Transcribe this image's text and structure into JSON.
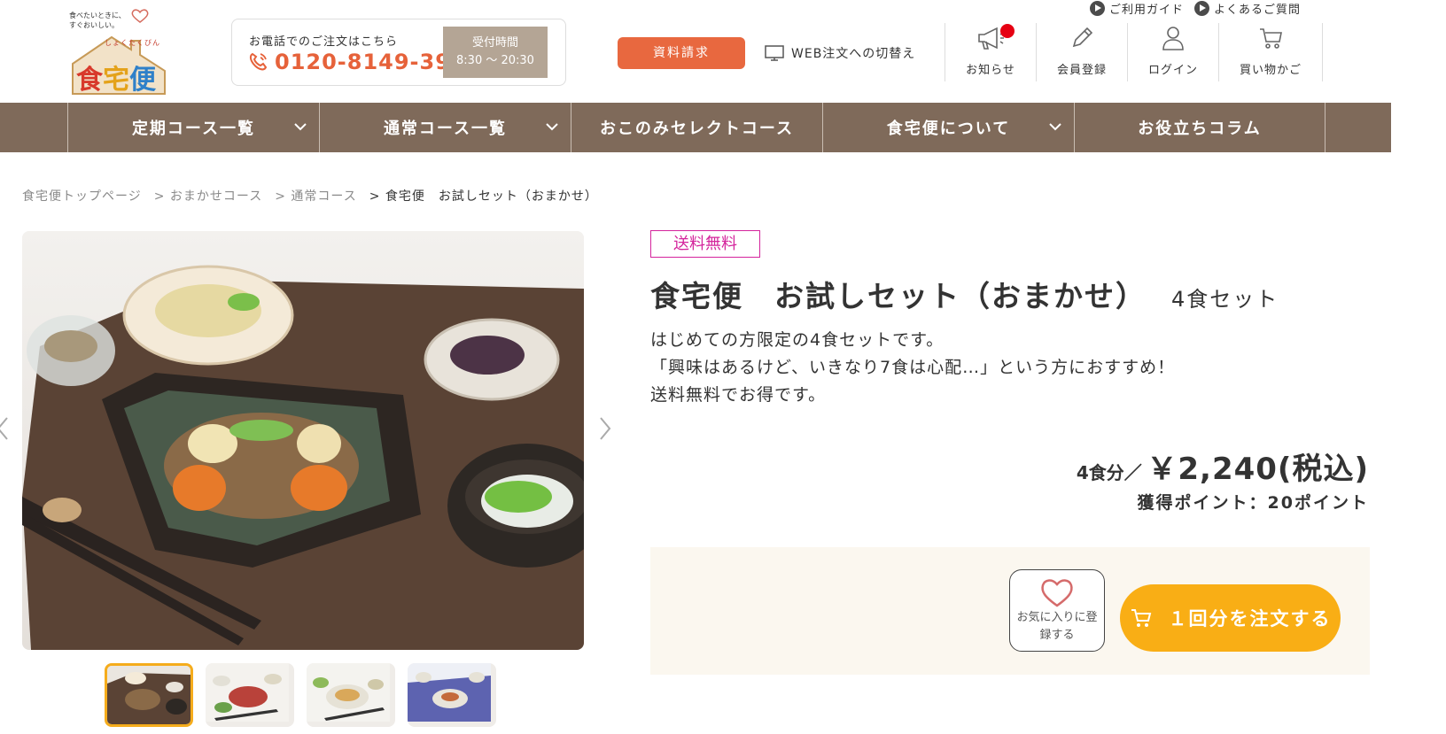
{
  "logo": {
    "tagline": "食べたいときに、すぐおいしい。",
    "ruby": "しょくたくびん",
    "brand_chars": [
      "食",
      "宅",
      "便"
    ]
  },
  "phone": {
    "label": "お電話でのご注文はこちら",
    "number": "0120-8149-39",
    "hours_label": "受付時間",
    "hours": "8:30 ～ 20:30"
  },
  "header": {
    "doc_request": "資料請求",
    "web_switch": "WEB注文への切替え",
    "top_links": [
      "ご利用ガイド",
      "よくあるご質問"
    ],
    "utils": [
      {
        "label": "お知らせ",
        "icon": "megaphone-icon"
      },
      {
        "label": "会員登録",
        "icon": "pencil-icon"
      },
      {
        "label": "ログイン",
        "icon": "user-icon"
      },
      {
        "label": "買い物かご",
        "icon": "cart-icon"
      }
    ]
  },
  "nav": {
    "items": [
      "定期コース一覧",
      "通常コース一覧",
      "おこのみセレクトコース",
      "食宅便について",
      "お役立ちコラム"
    ]
  },
  "breadcrumb": [
    "食宅便トップページ",
    "> おまかせコース",
    "> 通常コース",
    "> 食宅便　お試しセット（おまかせ）"
  ],
  "product": {
    "badge": "送料無料",
    "title": "食宅便　お試しセット（おまかせ）",
    "subtitle": "4食セット",
    "desc": [
      "はじめての方限定の4食セットです。",
      "「興味はあるけど、いきなり7食は心配…」という方におすすめ！",
      "送料無料でお得です。"
    ],
    "qty": "4食分／",
    "price": "￥2,240(税込)",
    "points": "獲得ポイント：20ポイント"
  },
  "actions": {
    "fav_line1": "お気に入りに登",
    "fav_line2": "録する",
    "order": "１回分を注文する"
  },
  "colors": {
    "nav_bg": "#7f6a5a",
    "accent_orange": "#e8683f",
    "order_yellow": "#f9ae15",
    "badge_pink": "#d4249c",
    "hours_bg": "#b4a595"
  }
}
